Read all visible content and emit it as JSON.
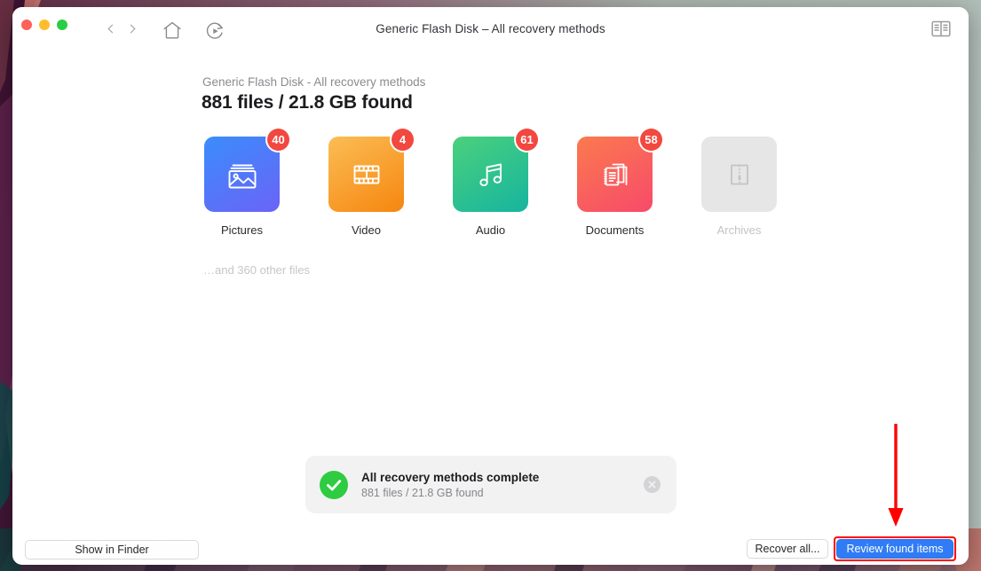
{
  "window": {
    "title": "Generic Flash Disk – All recovery methods",
    "traffic_lights": [
      "close-red",
      "minimize-yellow",
      "maximize-green"
    ],
    "toolbar": {
      "back_icon": "chevron-left-icon",
      "forward_icon": "chevron-right-icon",
      "home_icon": "home-icon",
      "scan_icon": "play-circle-icon",
      "panel_toggle_icon": "sidebar-panel-icon"
    }
  },
  "main": {
    "subtitle": "Generic Flash Disk - All recovery methods",
    "headline": "881 files / 21.8 GB found",
    "other_files": "…and 360 other files"
  },
  "categories": [
    {
      "label": "Pictures",
      "count": "40",
      "icon": "photo-icon",
      "enabled": true,
      "color_from": "#3a8dfb",
      "color_to": "#6b63f7"
    },
    {
      "label": "Video",
      "count": "4",
      "icon": "film-strip-icon",
      "enabled": true,
      "color_from": "#f9b64c",
      "color_to": "#f68913"
    },
    {
      "label": "Audio",
      "count": "61",
      "icon": "music-note-icon",
      "enabled": true,
      "color_from": "#4bd07c",
      "color_to": "#16b5a0"
    },
    {
      "label": "Documents",
      "count": "58",
      "icon": "documents-icon",
      "enabled": true,
      "color_from": "#fb7a4e",
      "color_to": "#f74a6a"
    },
    {
      "label": "Archives",
      "count": "",
      "icon": "zip-archive-icon",
      "enabled": false,
      "color_from": "#e6e6e6",
      "color_to": "#e6e6e6"
    }
  ],
  "toast": {
    "title": "All recovery methods complete",
    "subtitle": "881 files / 21.8 GB found",
    "status_icon": "check-circle-icon",
    "close_icon": "close-icon",
    "accent": "#2ecc40"
  },
  "footer": {
    "show_in_finder": "Show in Finder",
    "recover_all": "Recover all...",
    "review_found_items": "Review found items",
    "primary_color": "#2f7cf6"
  },
  "annotation": {
    "color": "#ff0000",
    "arrow_icon": "down-arrow-icon",
    "highlight_target": "review-found-items-button"
  }
}
